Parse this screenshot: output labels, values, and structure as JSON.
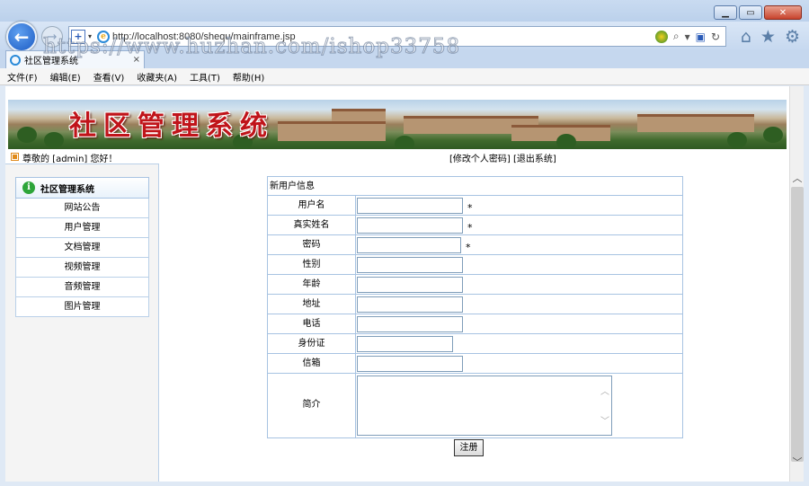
{
  "browser": {
    "address": "http://localhost:8080/shequ/mainframe.jsp",
    "tab_title": "社区管理系统",
    "watermark": "https://www.huzhan.com/ishop33758"
  },
  "menu": [
    "文件(F)",
    "编辑(E)",
    "查看(V)",
    "收藏夹(A)",
    "工具(T)",
    "帮助(H)"
  ],
  "banner": {
    "title": "社区管理系统"
  },
  "userbar": {
    "greeting": "尊敬的 [admin] 您好！",
    "links": "[修改个人密码] [退出系统]"
  },
  "sidebar": {
    "title": "社区管理系统",
    "items": [
      "网站公告",
      "用户管理",
      "文档管理",
      "视频管理",
      "音频管理",
      "图片管理"
    ]
  },
  "form": {
    "title": "新用户信息",
    "fields": [
      {
        "label": "用户名",
        "required": "*"
      },
      {
        "label": "真实姓名",
        "required": "*"
      },
      {
        "label": "密码",
        "required": "*"
      },
      {
        "label": "性别",
        "required": ""
      },
      {
        "label": "年龄",
        "required": ""
      },
      {
        "label": "地址",
        "required": ""
      },
      {
        "label": "电话",
        "required": ""
      },
      {
        "label": "身份证",
        "required": ""
      },
      {
        "label": "信箱",
        "required": ""
      }
    ],
    "intro_label": "简介",
    "submit_label": "注册"
  }
}
